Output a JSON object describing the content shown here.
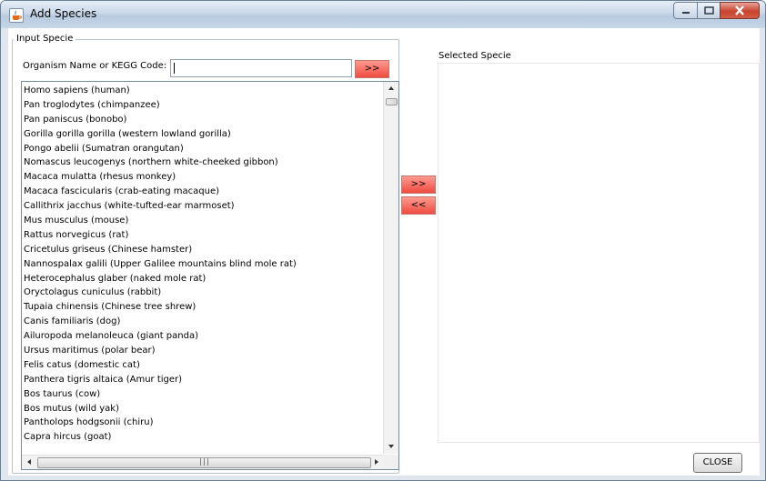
{
  "window": {
    "title": "Add Species",
    "icon": "java-cup-icon"
  },
  "input_group": {
    "legend": "Input Specie",
    "search_label": "Organism Name or KEGG Code:",
    "search_value": "",
    "search_button_label": ">>"
  },
  "organism_list": [
    "Homo sapiens (human)",
    "Pan troglodytes (chimpanzee)",
    "Pan paniscus (bonobo)",
    "Gorilla gorilla gorilla (western lowland gorilla)",
    "Pongo abelii (Sumatran orangutan)",
    "Nomascus leucogenys (northern white-cheeked gibbon)",
    "Macaca mulatta (rhesus monkey)",
    "Macaca fascicularis (crab-eating macaque)",
    "Callithrix jacchus (white-tufted-ear marmoset)",
    "Mus musculus (mouse)",
    "Rattus norvegicus (rat)",
    "Cricetulus griseus (Chinese hamster)",
    "Nannospalax galili (Upper Galilee mountains blind mole rat)",
    "Heterocephalus glaber (naked mole rat)",
    "Oryctolagus cuniculus (rabbit)",
    "Tupaia chinensis (Chinese tree shrew)",
    "Canis familiaris (dog)",
    "Ailuropoda melanoleuca (giant panda)",
    "Ursus maritimus (polar bear)",
    "Felis catus (domestic cat)",
    "Panthera tigris altaica (Amur tiger)",
    "Bos taurus (cow)",
    "Bos mutus (wild yak)",
    "Pantholops hodgsonii (chiru)",
    "Capra hircus (goat)"
  ],
  "transfer": {
    "add_label": ">>",
    "remove_label": "<<"
  },
  "selected": {
    "label": "Selected Specie",
    "items": []
  },
  "footer": {
    "close_label": "CLOSE"
  },
  "colors": {
    "accent_button": "#ef4b3f",
    "close_window": "#c7452f"
  }
}
